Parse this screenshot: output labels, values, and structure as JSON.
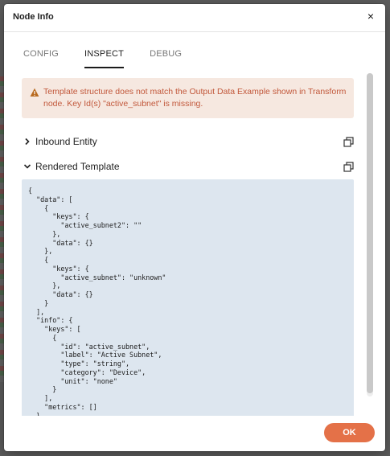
{
  "dialog": {
    "title": "Node Info",
    "close_label": "×"
  },
  "tabs": [
    {
      "label": "CONFIG",
      "active": false
    },
    {
      "label": "INSPECT",
      "active": true
    },
    {
      "label": "DEBUG",
      "active": false
    }
  ],
  "warning": {
    "message": "Template structure does not match the Output Data Example shown in Transform node. Key Id(s) \"active_subnet\" is missing.",
    "icon": "warning-triangle-icon",
    "color": "#c2593c"
  },
  "sections": [
    {
      "label": "Inbound Entity",
      "expanded": false
    },
    {
      "label": "Rendered Template",
      "expanded": true
    }
  ],
  "rendered_template_code": "{\n  \"data\": [\n    {\n      \"keys\": {\n        \"active_subnet2\": \"\"\n      },\n      \"data\": {}\n    },\n    {\n      \"keys\": {\n        \"active_subnet\": \"unknown\"\n      },\n      \"data\": {}\n    }\n  ],\n  \"info\": {\n    \"keys\": [\n      {\n        \"id\": \"active_subnet\",\n        \"label\": \"Active Subnet\",\n        \"type\": \"string\",\n        \"category\": \"Device\",\n        \"unit\": \"none\"\n      }\n    ],\n    \"metrics\": []\n  }\n}",
  "footer": {
    "ok_label": "OK",
    "ok_color": "#e47148"
  }
}
